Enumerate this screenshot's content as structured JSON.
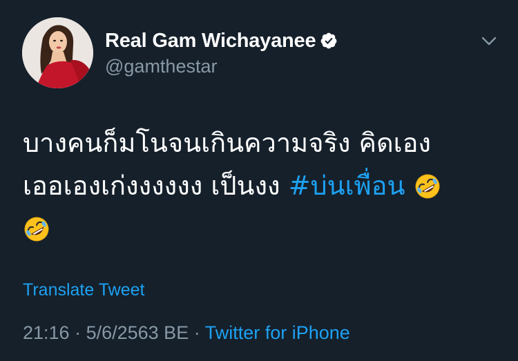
{
  "author": {
    "display_name": "Real Gam Wichayanee",
    "handle": "@gamthestar",
    "verified": true
  },
  "tweet": {
    "line1": "บางคนก็มโนจนเกินความจริง คิดเอง",
    "line2_text": "เออเองเก่งงงงงง เป็นงง ",
    "hashtag": "#บ่นเพื่อน",
    "emoji": "rolling-on-floor-laughing"
  },
  "translate_label": "Translate Tweet",
  "meta": {
    "time": "21:16",
    "separator": " · ",
    "date": "5/6/2563 BE",
    "source": "Twitter for iPhone"
  },
  "colors": {
    "background": "#15202b",
    "accent": "#1da1f2",
    "secondary_text": "#8899a6"
  }
}
